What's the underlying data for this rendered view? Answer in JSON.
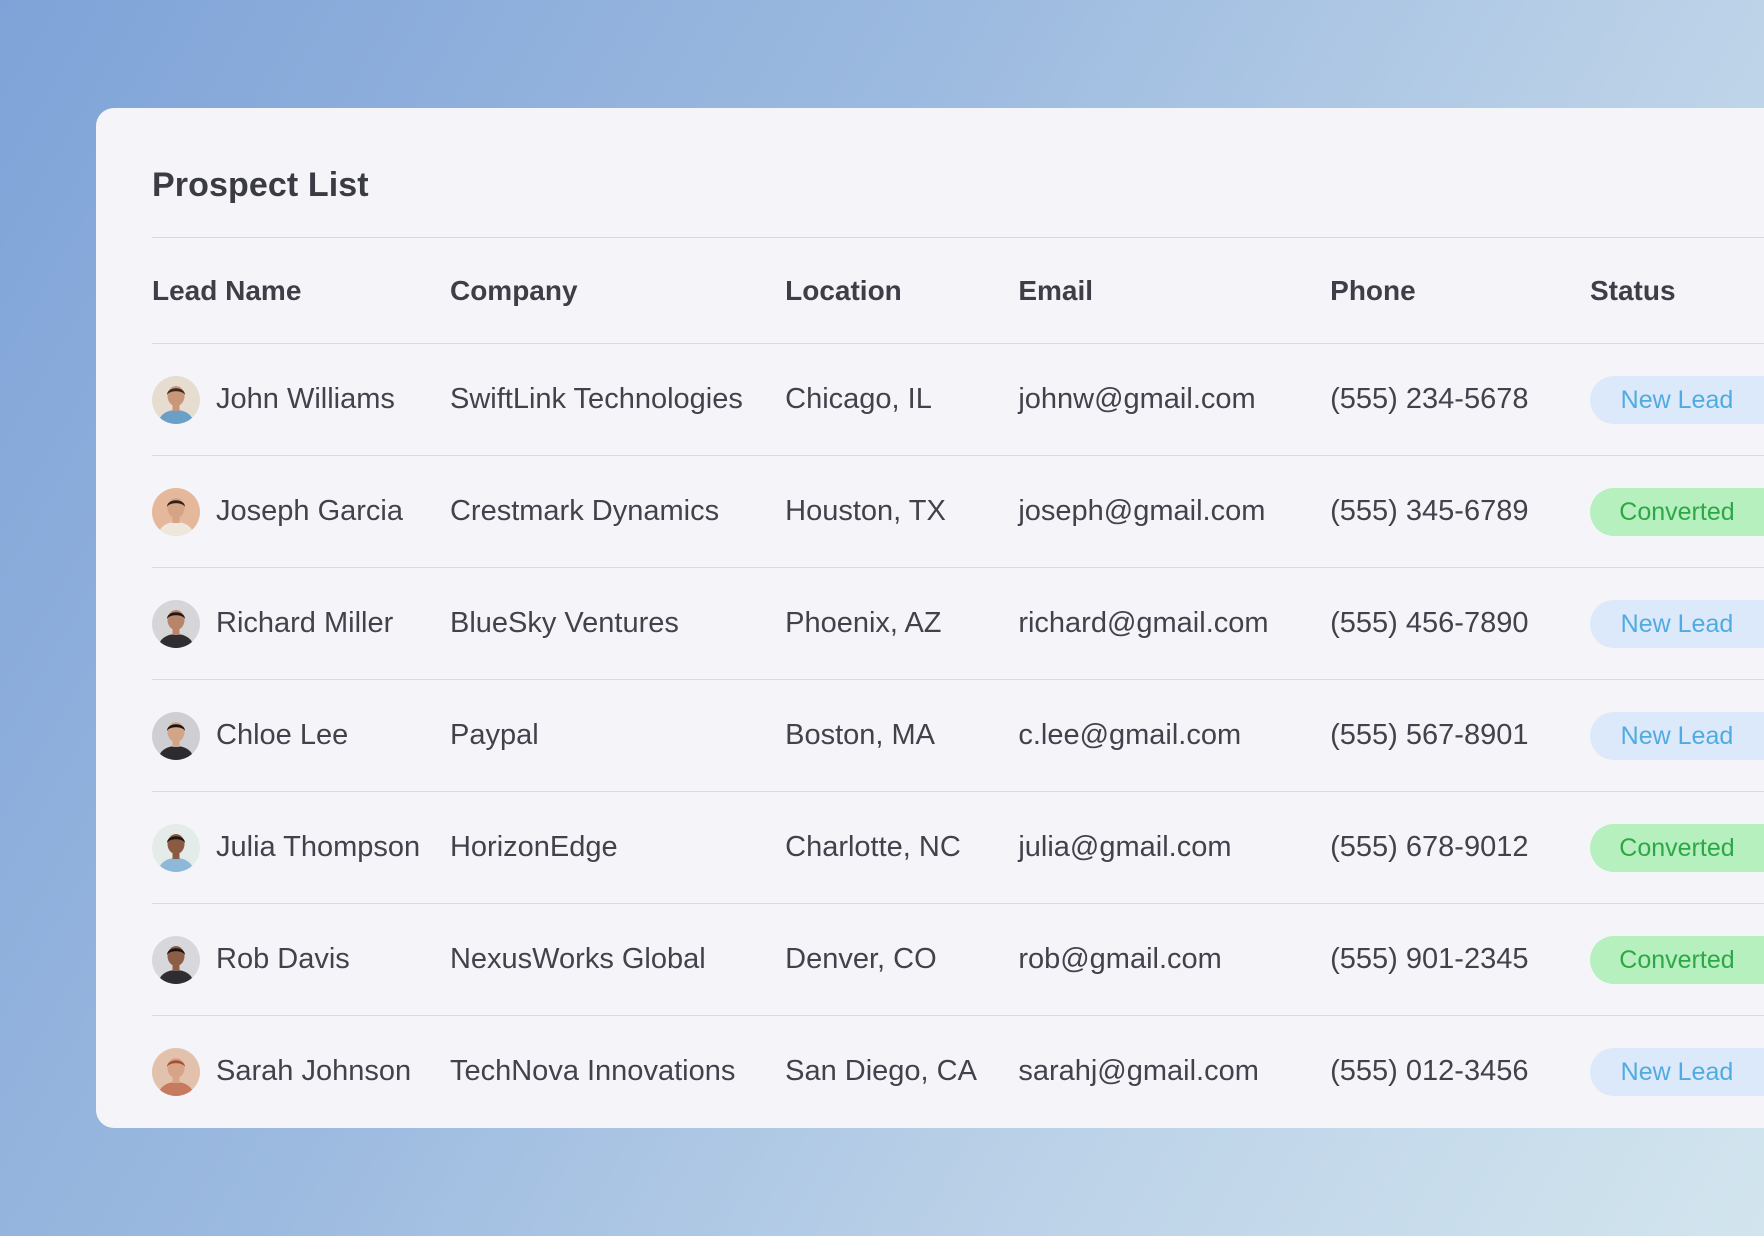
{
  "card": {
    "title": "Prospect List"
  },
  "table": {
    "columns": [
      "Lead Name",
      "Company",
      "Location",
      "Email",
      "Phone",
      "Status"
    ],
    "rows": [
      {
        "name": "John Williams",
        "company": "SwiftLink Technologies",
        "location": "Chicago, IL",
        "email": "johnw@gmail.com",
        "phone": "(555) 234-5678",
        "status": "New Lead",
        "status_type": "new",
        "avatar": {
          "skin": "#c89678",
          "hair": "#3b2a22",
          "shirt": "#6aa0c8",
          "bg": "#e6dccf"
        }
      },
      {
        "name": "Joseph Garcia",
        "company": "Crestmark Dynamics",
        "location": "Houston, TX",
        "email": "joseph@gmail.com",
        "phone": "(555) 345-6789",
        "status": "Converted",
        "status_type": "converted",
        "avatar": {
          "skin": "#d5a487",
          "hair": "#2f221c",
          "shirt": "#efe6dc",
          "bg": "#e5b79b"
        }
      },
      {
        "name": "Richard Miller",
        "company": "BlueSky Ventures",
        "location": "Phoenix, AZ",
        "email": "richard@gmail.com",
        "phone": "(555) 456-7890",
        "status": "New Lead",
        "status_type": "new",
        "avatar": {
          "skin": "#b9856a",
          "hair": "#1e1816",
          "shirt": "#2f2f33",
          "bg": "#d6d6d8"
        }
      },
      {
        "name": "Chloe Lee",
        "company": "Paypal",
        "location": "Boston, MA",
        "email": "c.lee@gmail.com",
        "phone": "(555) 567-8901",
        "status": "New Lead",
        "status_type": "new",
        "avatar": {
          "skin": "#d2a488",
          "hair": "#1a1414",
          "shirt": "#2b2b30",
          "bg": "#cfcfd3"
        }
      },
      {
        "name": "Julia Thompson",
        "company": "HorizonEdge",
        "location": "Charlotte, NC",
        "email": "julia@gmail.com",
        "phone": "(555) 678-9012",
        "status": "Converted",
        "status_type": "converted",
        "avatar": {
          "skin": "#8a5a42",
          "hair": "#1f1512",
          "shirt": "#8fb7d8",
          "bg": "#e4ecea"
        }
      },
      {
        "name": "Rob Davis",
        "company": "NexusWorks Global",
        "location": "Denver, CO",
        "email": "rob@gmail.com",
        "phone": "(555) 901-2345",
        "status": "Converted",
        "status_type": "converted",
        "avatar": {
          "skin": "#8c5e46",
          "hair": "#1b1412",
          "shirt": "#2e2e32",
          "bg": "#d8d8dc"
        }
      },
      {
        "name": "Sarah Johnson",
        "company": "TechNova Innovations",
        "location": "San Diego, CA",
        "email": "sarahj@gmail.com",
        "phone": "(555) 012-3456",
        "status": "New Lead",
        "status_type": "new",
        "avatar": {
          "skin": "#d8a487",
          "hair": "#a4533a",
          "shirt": "#c77b5e",
          "bg": "#e2c2ad"
        }
      }
    ]
  },
  "colors": {
    "new_lead_bg": "#dbe9fa",
    "new_lead_text": "#52abe0",
    "converted_bg": "#b6f0bf",
    "converted_text": "#2fa747"
  }
}
